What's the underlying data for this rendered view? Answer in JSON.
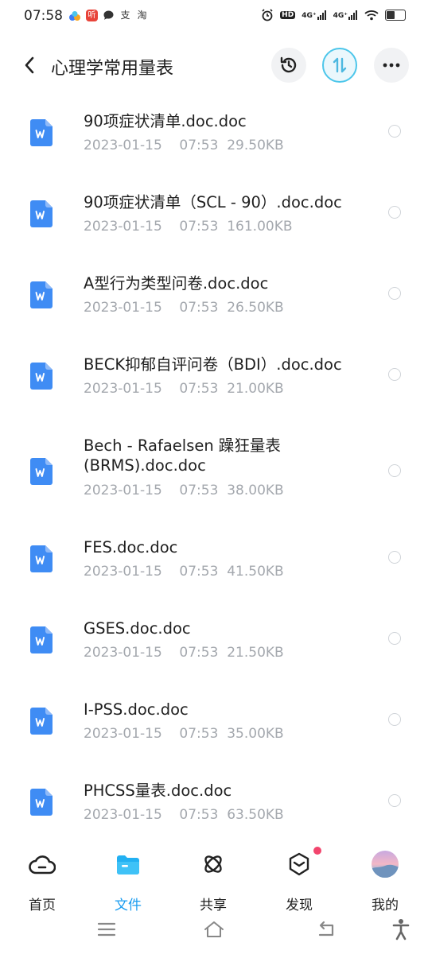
{
  "status_bar": {
    "time": "07:58",
    "apps": [
      {
        "icon": "cloud-app-icon",
        "color": "#3d7cf5",
        "glyph": ""
      },
      {
        "icon": "listen-app-icon",
        "color": "#e8443a",
        "glyph": "听"
      },
      {
        "icon": "chat-app-icon",
        "color": "#333333",
        "glyph": ""
      },
      {
        "icon": "alipay-app-icon",
        "color": "#333333",
        "glyph": "支"
      },
      {
        "icon": "taobao-app-icon",
        "color": "#333333",
        "glyph": "淘"
      }
    ],
    "hd_label": "HD",
    "signal1": "4G⁺",
    "signal2": "4G⁺"
  },
  "header": {
    "title": "心理学常用量表",
    "accent": "#4cc6ea"
  },
  "files": [
    {
      "name": "90项症状清单.doc.doc",
      "date": "2023-01-15",
      "time": "07:53",
      "size": "29.50KB"
    },
    {
      "name": "90项症状清单（SCL - 90）.doc.doc",
      "date": "2023-01-15",
      "time": "07:53",
      "size": "161.00KB"
    },
    {
      "name": "A型行为类型问卷.doc.doc",
      "date": "2023-01-15",
      "time": "07:53",
      "size": "26.50KB"
    },
    {
      "name": "BECK抑郁自评问卷（BDI）.doc.doc",
      "date": "2023-01-15",
      "time": "07:53",
      "size": "21.00KB"
    },
    {
      "name": "Bech - Rafaelsen  躁狂量表(BRMS).doc.doc",
      "date": "2023-01-15",
      "time": "07:53",
      "size": "38.00KB"
    },
    {
      "name": "FES.doc.doc",
      "date": "2023-01-15",
      "time": "07:53",
      "size": "41.50KB"
    },
    {
      "name": "GSES.doc.doc",
      "date": "2023-01-15",
      "time": "07:53",
      "size": "21.50KB"
    },
    {
      "name": "I-PSS.doc.doc",
      "date": "2023-01-15",
      "time": "07:53",
      "size": "35.00KB"
    },
    {
      "name": "PHCSS量表.doc.doc",
      "date": "2023-01-15",
      "time": "07:53",
      "size": "63.50KB"
    }
  ],
  "bottom_nav": [
    {
      "label": "首页",
      "icon": "home-cloud-icon",
      "active": false
    },
    {
      "label": "文件",
      "icon": "folder-icon",
      "active": true
    },
    {
      "label": "共享",
      "icon": "share-atom-icon",
      "active": false
    },
    {
      "label": "发现",
      "icon": "discover-cube-icon",
      "active": false
    },
    {
      "label": "我的",
      "icon": "avatar",
      "active": false
    }
  ],
  "colors": {
    "doc_icon": "#3f8cf4",
    "active_nav": "#1a9cf0",
    "notification": "#f2456d"
  }
}
